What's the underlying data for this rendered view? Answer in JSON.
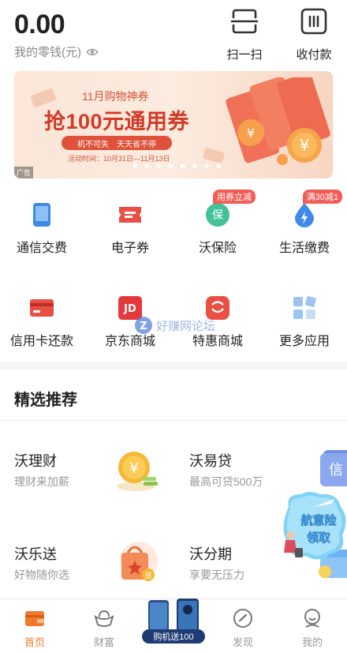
{
  "header": {
    "balance": "0.00",
    "balance_label": "我的零钱(元)",
    "scan_label": "扫一扫",
    "pay_label": "收付款"
  },
  "banner": {
    "title": "11月购物神券",
    "headline": "抢100元通用券",
    "pill": "机不可失　天天省不停",
    "date": "活动时间：10月31日—11月13日",
    "ad_tag": "广告",
    "active_dot": 4,
    "dot_count": 8
  },
  "apps": [
    {
      "label": "通信交费",
      "icon": "phone-icon"
    },
    {
      "label": "电子券",
      "icon": "ticket-icon"
    },
    {
      "label": "沃保险",
      "icon": "shield-icon",
      "badge": "用券立减"
    },
    {
      "label": "生活缴费",
      "icon": "water-drop-icon",
      "badge": "满30减1"
    },
    {
      "label": "信用卡还款",
      "icon": "credit-card-icon"
    },
    {
      "label": "京东商城",
      "icon": "jd-icon",
      "icon_text": "JD"
    },
    {
      "label": "特惠商城",
      "icon": "shop-bag-icon"
    },
    {
      "label": "更多应用",
      "icon": "grid-icon"
    }
  ],
  "watermark": "好赚网论坛",
  "section": {
    "title": "精选推荐"
  },
  "recommend": [
    {
      "title": "沃理财",
      "subtitle": "理财来加薪",
      "icon": "coin-icon"
    },
    {
      "title": "沃易贷",
      "subtitle": "最高可贷500万",
      "icon": "loan-wallet-icon"
    },
    {
      "title": "沃乐送",
      "subtitle": "好物随你选",
      "icon": "gift-bag-icon"
    },
    {
      "title": "沃分期",
      "subtitle": "享要无压力",
      "icon": "card-icon"
    }
  ],
  "float_promo": {
    "line1": "航意险",
    "line2": "领取"
  },
  "bottom_nav": {
    "tabs": [
      {
        "label": "首页",
        "icon": "home-icon",
        "active": true
      },
      {
        "label": "财富",
        "icon": "ingot-icon",
        "active": false
      },
      {
        "label": "发现",
        "icon": "compass-icon",
        "active": false
      },
      {
        "label": "我的",
        "icon": "user-icon",
        "active": false
      }
    ],
    "promo_label": "购机送100"
  },
  "colors": {
    "accent": "#f07a2c",
    "banner_red": "#d23a26",
    "badge_red": "#f25e57",
    "blue": "#3f8ae8"
  }
}
